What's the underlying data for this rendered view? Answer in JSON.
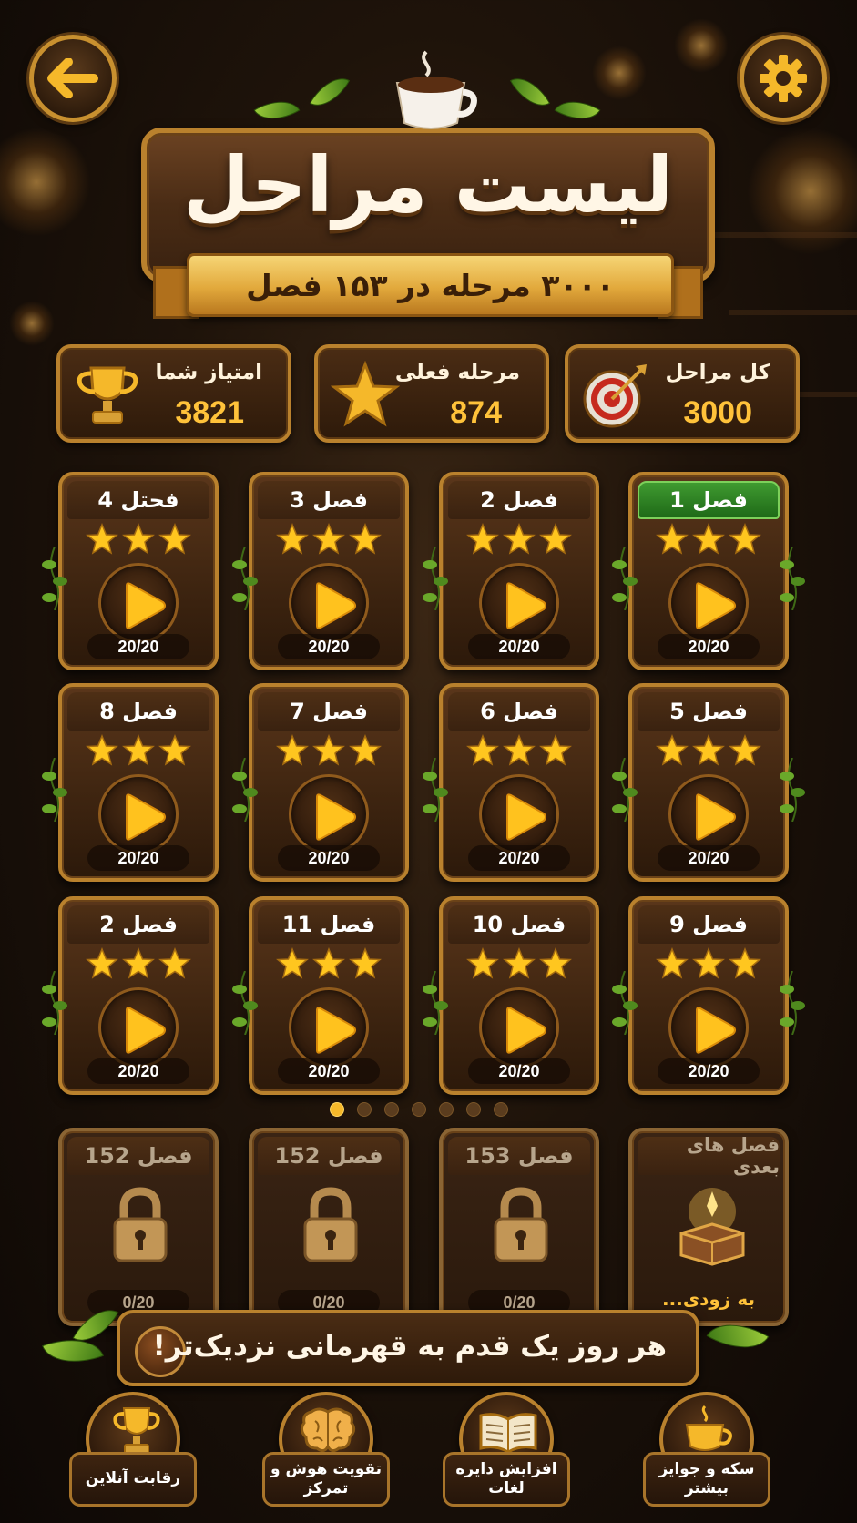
{
  "header": {
    "title": "لیست مراحل",
    "subtitle": "۳۰۰۰ مرحله در ۱۵۳ فصل",
    "back_icon": "arrow-left-icon",
    "settings_icon": "gear-icon"
  },
  "stats": [
    {
      "label": "کل مراحل",
      "value": "3000",
      "icon": "target-icon"
    },
    {
      "label": "مرحله فعلی",
      "value": "874",
      "icon": "star-icon"
    },
    {
      "label": "امتیاز شما",
      "value": "3821",
      "icon": "trophy-icon"
    }
  ],
  "chapters": [
    {
      "title": "فصل 1",
      "progress": "20/20",
      "stars": 3,
      "active": true
    },
    {
      "title": "فصل 2",
      "progress": "20/20",
      "stars": 3
    },
    {
      "title": "فصل 3",
      "progress": "20/20",
      "stars": 3
    },
    {
      "title": "فحتل 4",
      "progress": "20/20",
      "stars": 3
    },
    {
      "title": "فصل 5",
      "progress": "20/20",
      "stars": 3
    },
    {
      "title": "فصل 6",
      "progress": "20/20",
      "stars": 3
    },
    {
      "title": "فصل 7",
      "progress": "20/20",
      "stars": 3
    },
    {
      "title": "فصل 8",
      "progress": "20/20",
      "stars": 3
    },
    {
      "title": "فصل 9",
      "progress": "20/20",
      "stars": 3
    },
    {
      "title": "فصل 10",
      "progress": "20/20",
      "stars": 3
    },
    {
      "title": "فصل 11",
      "progress": "20/20",
      "stars": 3
    },
    {
      "title": "فصل 2",
      "progress": "20/20",
      "stars": 3
    }
  ],
  "pager": {
    "count": 7,
    "active": 0
  },
  "locked": [
    {
      "title": "فصل های بعدی",
      "note": "به زودی...",
      "type": "coming-soon"
    },
    {
      "title": "فصل 153",
      "progress": "0/20"
    },
    {
      "title": "فصل 152",
      "progress": "0/20"
    },
    {
      "title": "فصل 152",
      "progress": "0/20"
    }
  ],
  "motto": "هر روز یک قدم به قهرمانی نزدیک‌تر!",
  "nav": [
    {
      "label": "سکه و جوایز بیشتر",
      "icon": "coffee-cup-icon"
    },
    {
      "label": "افزایش دایره لغات",
      "icon": "book-icon"
    },
    {
      "label": "تقویت هوش و تمرکز",
      "icon": "brain-icon"
    },
    {
      "label": "رقابت آنلاین",
      "icon": "trophy-icon"
    }
  ],
  "colors": {
    "accent": "#ffc23a",
    "frame": "#b9812d",
    "active": "#3f9a30"
  }
}
